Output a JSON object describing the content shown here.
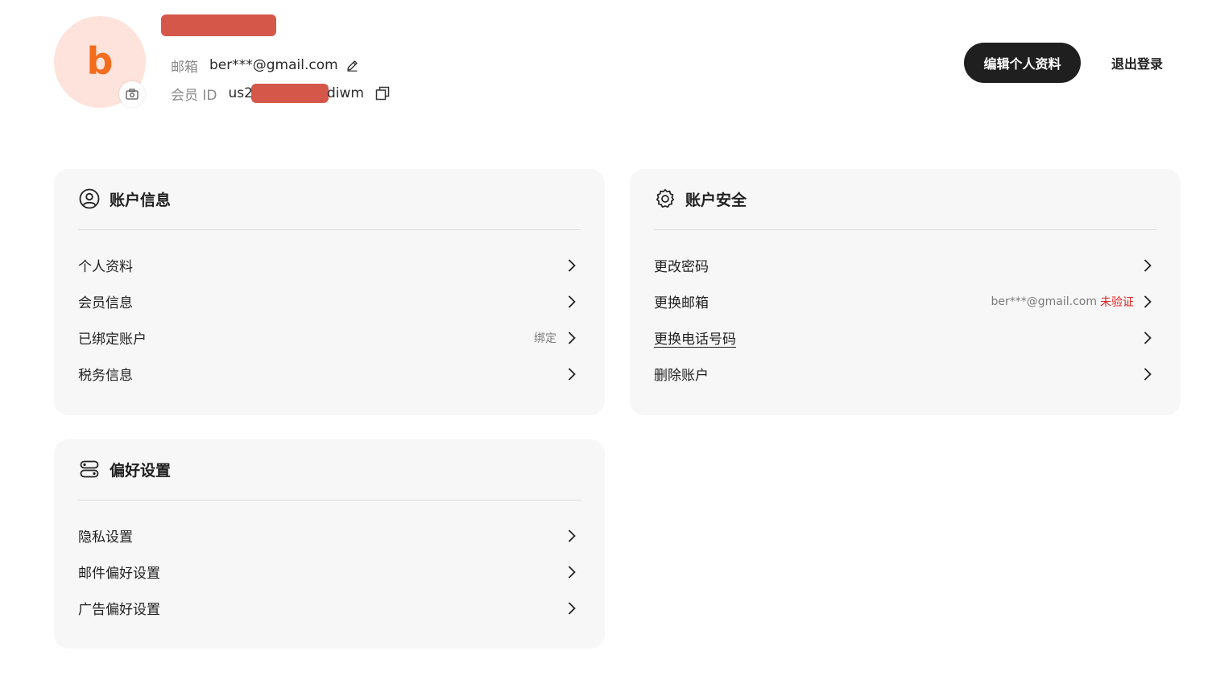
{
  "profile": {
    "avatar_letter": "b",
    "email_label": "邮箱",
    "email_value": "ber***@gmail.com",
    "member_id_label": "会员 ID",
    "member_id_prefix": "us2",
    "member_id_suffix": "diwm",
    "edit_profile_label": "编辑个人资料",
    "logout_label": "退出登录"
  },
  "account_info": {
    "title": "账户信息",
    "items": [
      {
        "label": "个人资料",
        "extra": ""
      },
      {
        "label": "会员信息",
        "extra": ""
      },
      {
        "label": "已绑定账户",
        "extra": "绑定"
      },
      {
        "label": "税务信息",
        "extra": ""
      }
    ]
  },
  "account_security": {
    "title": "账户安全",
    "items": [
      {
        "label": "更改密码"
      },
      {
        "label": "更换邮箱",
        "extra_email": "ber***@gmail.com",
        "warning": "未验证"
      },
      {
        "label": "更换电话号码"
      },
      {
        "label": "删除账户"
      }
    ]
  },
  "preferences": {
    "title": "偏好设置",
    "items": [
      {
        "label": "隐私设置"
      },
      {
        "label": "邮件偏好设置"
      },
      {
        "label": "广告偏好设置"
      }
    ]
  },
  "colors": {
    "avatar_bg": "#fde3db",
    "avatar_letter": "#f46c1e",
    "primary_button": "#1f1f1f",
    "warning_text": "#e02020",
    "card_bg": "#f7f7f7",
    "redaction": "#d5574a"
  },
  "icons": {
    "avatar_camera": "camera-icon",
    "email_edit": "pencil-icon",
    "member_id_copy": "copy-icon",
    "account_info": "user-circle-icon",
    "account_security": "gear-icon",
    "preferences": "toggle-settings-icon",
    "row_arrow": "chevron-right-icon"
  }
}
